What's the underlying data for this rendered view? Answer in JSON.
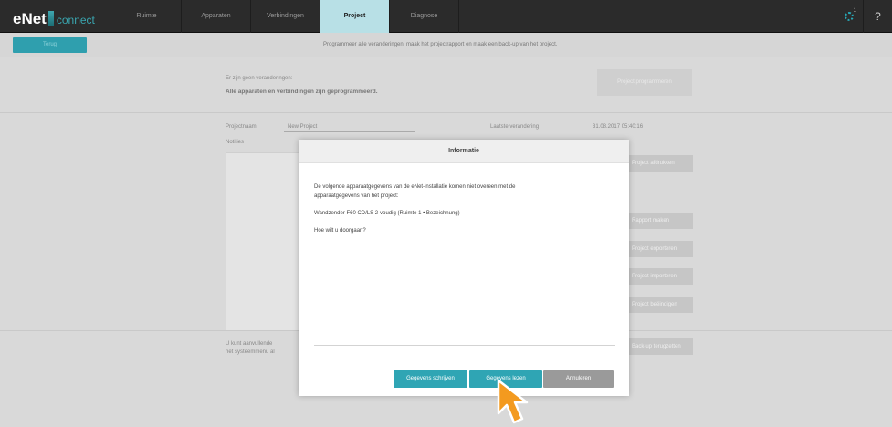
{
  "app": {
    "logo_main": "eNet",
    "logo_sub": "connect"
  },
  "nav": {
    "tabs": [
      {
        "label": "Ruimte"
      },
      {
        "label": "Apparaten"
      },
      {
        "label": "Verbindingen"
      },
      {
        "label": "Project"
      },
      {
        "label": "Diagnose"
      }
    ],
    "active_index": 3,
    "notification_count": "1",
    "help_label": "?"
  },
  "subbar": {
    "button_label": "Terug",
    "info_text": "Programmeer alle veranderingen, maak het projectrapport en maak een back-up van het project."
  },
  "main": {
    "changes_label": "Er zijn geen veranderingen:",
    "changes_bold": "Alle apparaten en verbindingen zijn geprogrammeerd.",
    "program_button": "Project programmeren",
    "project_name_label": "Projectnaam:",
    "project_name_value": "New Project",
    "last_modified_label": "Laatste verandering",
    "last_modified_value": "31.08.2017 05:40:16",
    "notes_label": "Notities",
    "side_buttons": [
      "Project afdrukken",
      "Rapport maken",
      "Project exporteren",
      "Project importeren",
      "Project beëindigen",
      "Back-up terugzetten"
    ],
    "bottom_text_line1": "U kunt aanvullende",
    "bottom_text_line2": "het systeemmenu al"
  },
  "modal": {
    "title": "Informatie",
    "line1": "De volgende apparaatgegevens van de eNet-installatie komen niet overeen met de",
    "line2": "apparaatgegevens van het project:",
    "device": "Wandzender F60 CD/LS 2-voudig (Ruimte 1 • Bezeichnung)",
    "question": "Hoe wilt u doorgaan?",
    "btn_write": "Gegevens schrijven",
    "btn_read": "Gegevens lezen",
    "btn_cancel": "Annuleren"
  },
  "colors": {
    "accent": "#2fa5b4",
    "active_tab": "#b8e0e6",
    "topbar": "#2b2b2b"
  }
}
